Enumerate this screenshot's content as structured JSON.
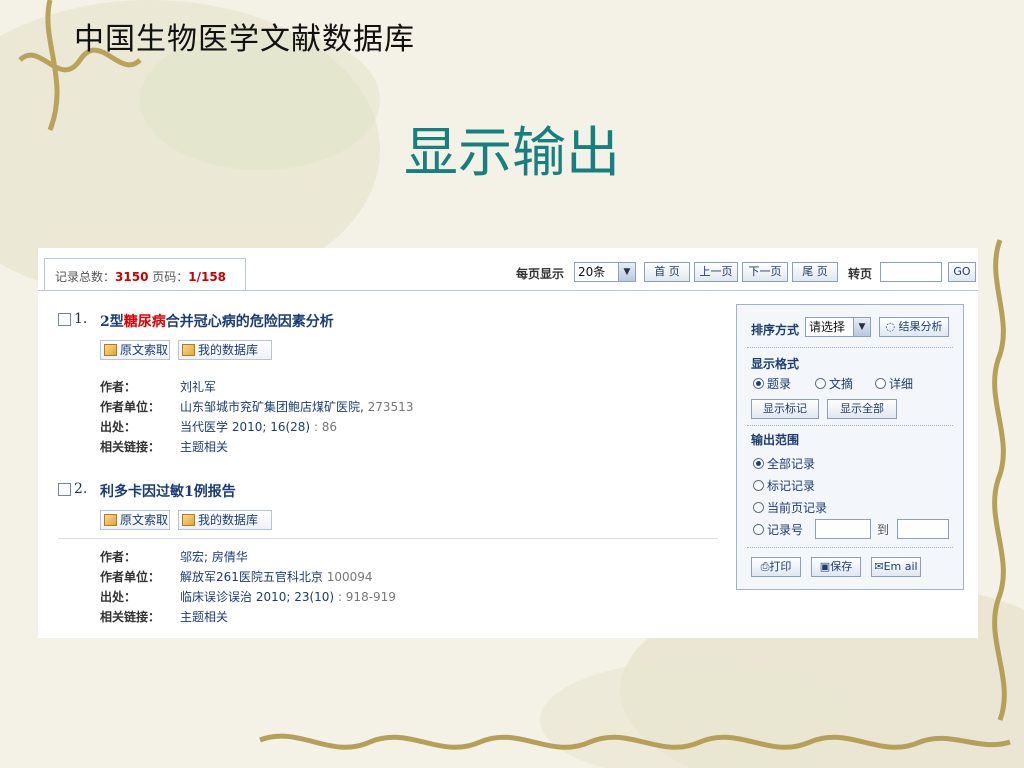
{
  "slide": {
    "title": "中国生物医学文献数据库",
    "heading": "显示输出"
  },
  "summary": {
    "total_label": "记录总数：",
    "total": "3150",
    "page_label": " 页码：",
    "page": "1/158"
  },
  "pager": {
    "per_page_label": "每页显示",
    "per_page_value": "20条",
    "first": "首 页",
    "prev": "上一页",
    "next": "下一页",
    "last": "尾 页",
    "goto_label": "转页",
    "go": "GO"
  },
  "actions": {
    "fulltext": "原文索取",
    "mydb": "我的数据库"
  },
  "labels": {
    "author": "作者：",
    "affiliation": "作者单位：",
    "source": "出处：",
    "links": "相关链接："
  },
  "records": [
    {
      "num": "1.",
      "title_pre": "2型",
      "title_hl": "糖尿病",
      "title_post": "合并冠心病的危险因素分析",
      "author": "刘礼军",
      "affiliation": "山东邹城市兖矿集团鲍店煤矿医院,",
      "zip": " 273513",
      "source": "当代医学 2010; 16(28)",
      "pages": " : 86",
      "links": "主题相关"
    },
    {
      "num": "2.",
      "title_pre": "利多卡因过敏1例报告",
      "title_hl": "",
      "title_post": "",
      "author": "邬宏; 房倩华",
      "affiliation": "解放军261医院五官科北京",
      "zip": "  100094",
      "source": "临床误诊误治 2010; 23(10)",
      "pages": " : 918-919",
      "links": "主题相关"
    }
  ],
  "side": {
    "sort_label": "排序方式",
    "sort_value": "请选择",
    "analysis": "结果分析",
    "format_label": "显示格式",
    "format_options": [
      "题录",
      "文摘",
      "详细"
    ],
    "show_marked": "显示标记",
    "show_all": "显示全部",
    "range_label": "输出范围",
    "range_options": [
      "全部记录",
      "标记记录",
      "当前页记录",
      "记录号"
    ],
    "to_label": "到",
    "print": "打印",
    "save": "保存",
    "email": "Em ail"
  }
}
